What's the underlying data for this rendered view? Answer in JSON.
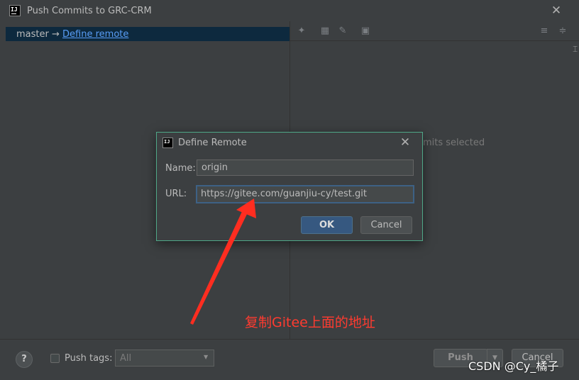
{
  "window": {
    "title": "Push Commits to GRC-CRM",
    "app_icon_text": "IJ"
  },
  "left_panel": {
    "branch_name": "master",
    "arrow": "→",
    "remote_link": "Define remote"
  },
  "right_panel": {
    "partial_status_text": "mits selected"
  },
  "bottom_bar": {
    "help_label": "?",
    "push_tags_label": "Push tags:",
    "tags_select_value": "All",
    "push_button": "Push",
    "cancel_button": "Cancel"
  },
  "dialog": {
    "title": "Define Remote",
    "name_label": "Name:",
    "name_value": "origin",
    "url_label": "URL:",
    "url_value": "https://gitee.com/guanjiu-cy/test.git",
    "ok_button": "OK",
    "cancel_button": "Cancel"
  },
  "annotation": {
    "text": "复制Gitee上面的地址",
    "color": "#ff3b30"
  },
  "watermark": "CSDN @Cy_橘子",
  "colors": {
    "background": "#3c3f41",
    "selection": "#0d293e",
    "link": "#589df6",
    "dialog_border": "#4fa888",
    "ok_button": "#365880",
    "input_focus": "#3d6185"
  }
}
